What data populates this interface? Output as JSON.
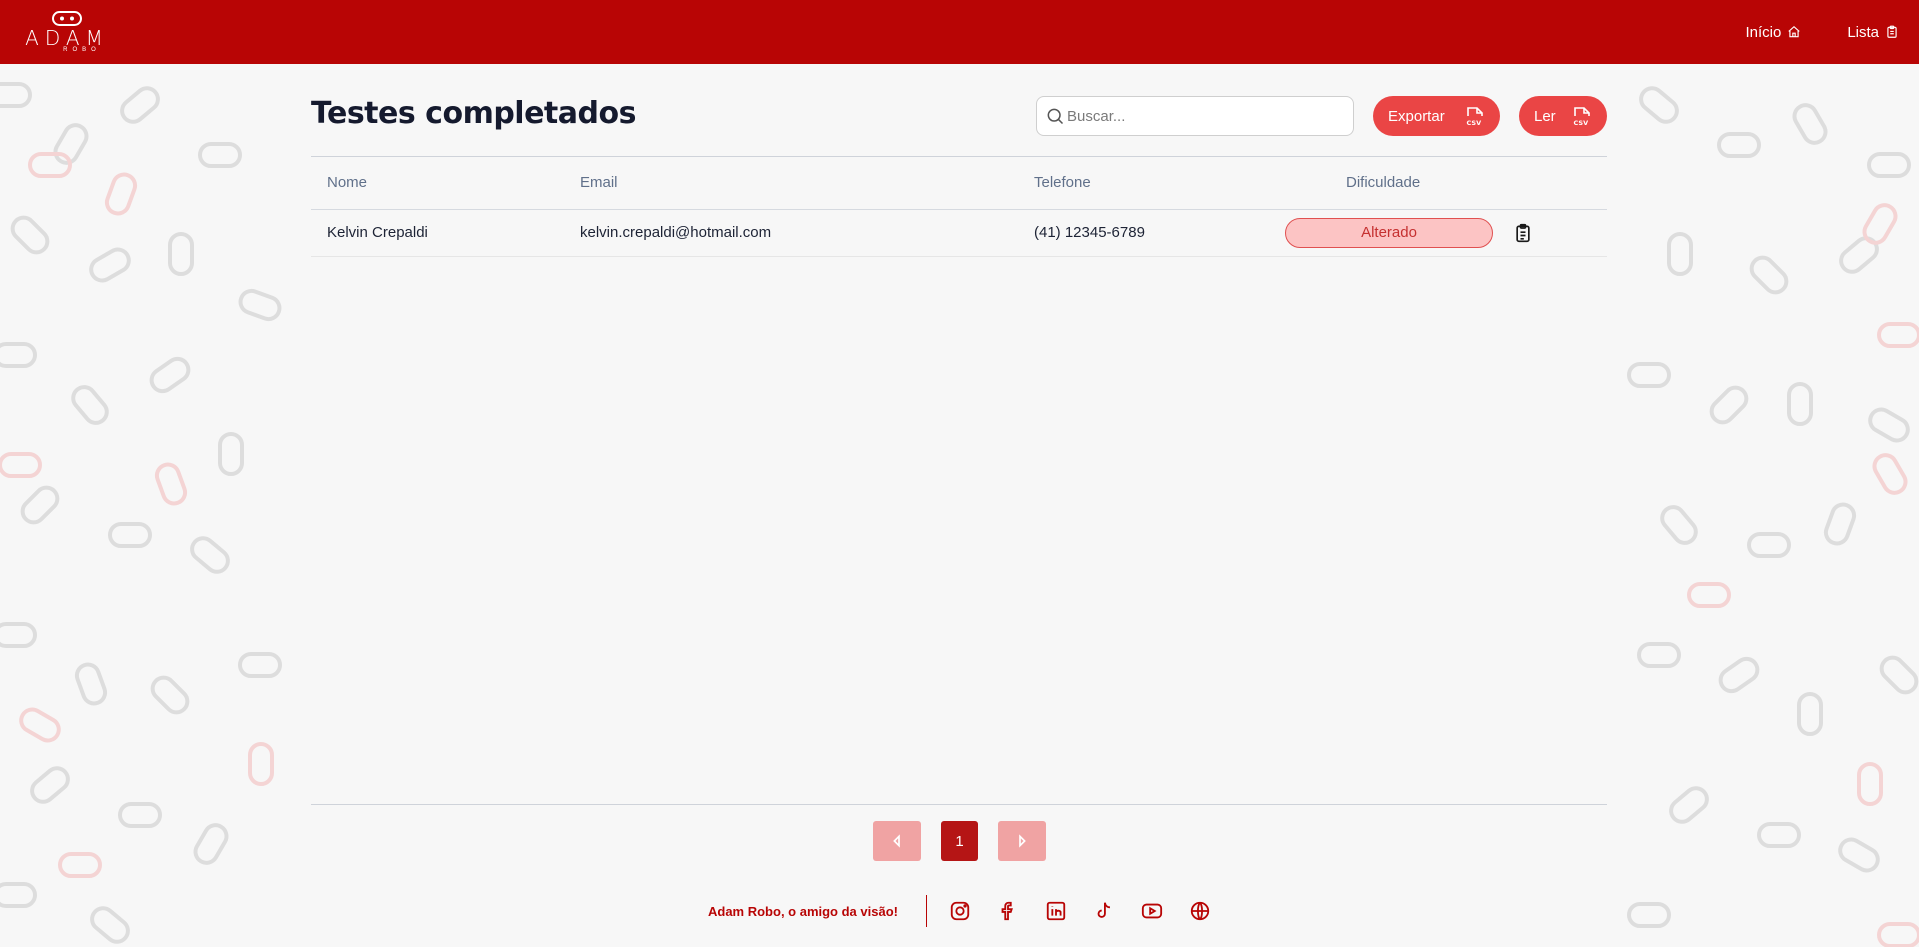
{
  "navbar": {
    "logo_text": "ADAM",
    "logo_subtext": "ROBO",
    "links": [
      {
        "label": "Início",
        "icon": "home-icon"
      },
      {
        "label": "Lista",
        "icon": "clipboard-icon"
      }
    ]
  },
  "page": {
    "title": "Testes completados",
    "search_placeholder": "Buscar...",
    "export_label": "Exportar",
    "read_label": "Ler"
  },
  "table": {
    "columns": [
      "Nome",
      "Email",
      "Telefone",
      "Dificuldade"
    ],
    "rows": [
      {
        "name": "Kelvin Crepaldi",
        "email": "kelvin.crepaldi@hotmail.com",
        "phone": "(41) 12345-6789",
        "difficulty": "Alterado"
      }
    ]
  },
  "pagination": {
    "current_page": "1"
  },
  "footer": {
    "tagline": "Adam Robo, o amigo da visão!",
    "social": [
      "instagram-icon",
      "facebook-icon",
      "linkedin-icon",
      "tiktok-icon",
      "youtube-icon",
      "globe-icon"
    ]
  },
  "colors": {
    "brand": "#b80505",
    "button": "#ea4545",
    "badge_bg": "#fcc4c4",
    "badge_text": "#c53030"
  }
}
